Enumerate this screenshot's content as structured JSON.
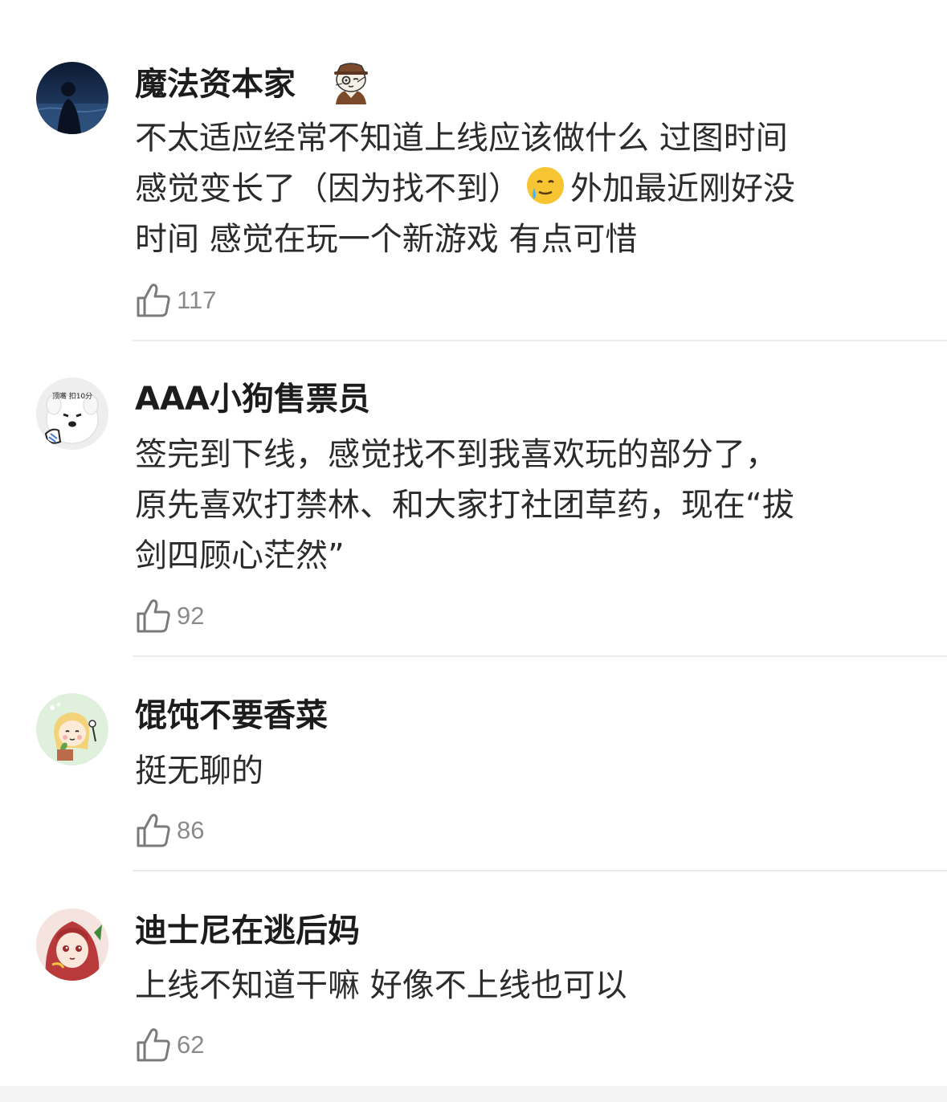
{
  "comments": [
    {
      "username": "魔法资本家",
      "has_badge": true,
      "lines": [
        "不太适应经常不知道上线应该做什么 过图时间",
        "感觉变长了（因为找不到）",
        "时间 感觉在玩一个新游戏 有点可惜"
      ],
      "line2_tail": "外加最近刚好没",
      "inline_emoji": "crying-smile-emoji",
      "likes": "117"
    },
    {
      "username": "AAA小狗售票员",
      "avatar_caption": "顶嘴 扣10分",
      "lines": [
        "签完到下线，感觉找不到我喜欢玩的部分了，",
        "原先喜欢打禁林、和大家打社团草药，现在“拔",
        "剑四顾心茫然”"
      ],
      "likes": "92"
    },
    {
      "username": "馄饨不要香菜",
      "lines": [
        "挺无聊的"
      ],
      "likes": "86"
    },
    {
      "username": "迪士尼在逃后妈",
      "lines": [
        "上线不知道干嘛 好像不上线也可以"
      ],
      "likes": "62"
    }
  ],
  "icons": {
    "like": "thumbs-up-icon",
    "badge": "detective-cat-badge-icon"
  },
  "colors": {
    "text_primary": "#1c1c1c",
    "text_body": "#2b2b2b",
    "text_muted": "#8a8a8a",
    "divider": "#ececec"
  }
}
